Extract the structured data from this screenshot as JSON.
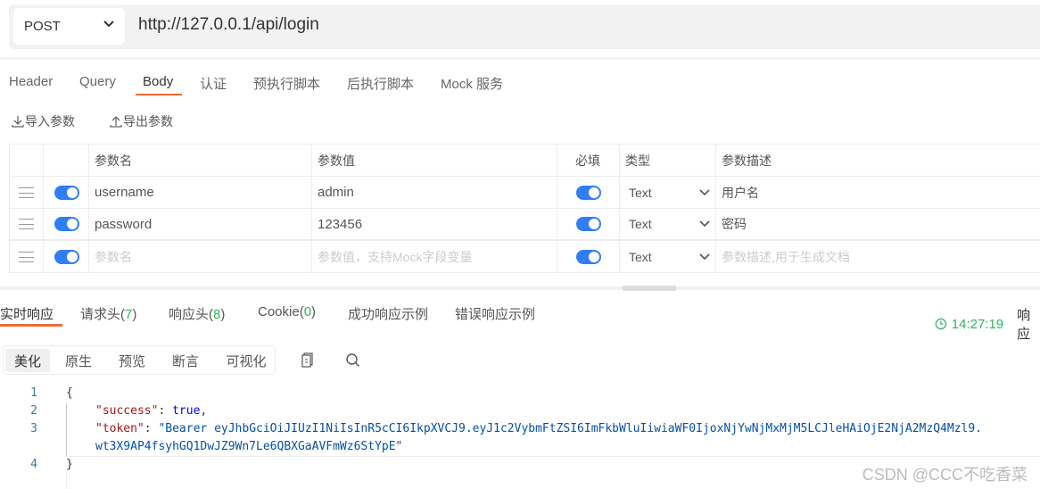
{
  "request": {
    "method": "POST",
    "url": "http://127.0.0.1/api/login"
  },
  "tabs": [
    {
      "label": "Header"
    },
    {
      "label": "Query"
    },
    {
      "label": "Body",
      "active": true
    },
    {
      "label": "认证"
    },
    {
      "label": "预执行脚本"
    },
    {
      "label": "后执行脚本"
    },
    {
      "label": "Mock 服务"
    }
  ],
  "toolbar": {
    "import": "导入参数",
    "export": "导出参数"
  },
  "table": {
    "headers": {
      "name": "参数名",
      "value": "参数值",
      "required": "必填",
      "type": "类型",
      "desc": "参数描述"
    },
    "rows": [
      {
        "enabled": true,
        "name": "username",
        "value": "admin",
        "required": true,
        "type": "Text",
        "desc": "用户名"
      },
      {
        "enabled": true,
        "name": "password",
        "value": "123456",
        "required": true,
        "type": "Text",
        "desc": "密码"
      }
    ],
    "new_row": {
      "enabled": true,
      "name_placeholder": "参数名",
      "value_placeholder": "参数值，支持Mock字段变量",
      "required": true,
      "type": "Text",
      "desc_placeholder": "参数描述,用于生成文档"
    }
  },
  "response": {
    "tabs": [
      {
        "label": "实时响应",
        "active": true
      },
      {
        "label": "请求头(",
        "count": "7"
      },
      {
        "label": "响应头(",
        "count": "8"
      },
      {
        "label": "Cookie(",
        "count": "0"
      },
      {
        "label": "成功响应示例"
      },
      {
        "label": "错误响应示例"
      }
    ],
    "time": "14:27:19",
    "extra": "响应",
    "view_modes": [
      "美化",
      "原生",
      "预览",
      "断言",
      "可视化"
    ],
    "code": {
      "l1": "{",
      "k2": "\"success\"",
      "v2": "true",
      "k3": "\"token\"",
      "v3a": "\"Bearer eyJhbGciOiJIUzI1NiIsInR5cCI6IkpXVCJ9.eyJ1c2VybmFtZSI6ImFkbWluIiwiaWF0IjoxNjYwNjMxMjM5LCJleHAiOjE2NjA2MzQ4Mzl9.",
      "v3b": "wt3X9AP4fsyhGQ1DwJZ9Wn7Le6QBXGaAVFmWz6StYpE\"",
      "l4": "}"
    }
  },
  "watermark": "CSDN @CCC不吃香菜",
  "colors": {
    "accent": "#f06a35",
    "toggle": "#2f7ef5",
    "success": "#2db45d"
  }
}
